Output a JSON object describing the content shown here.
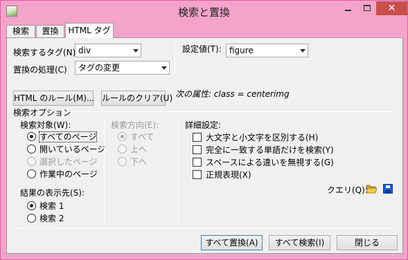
{
  "window": {
    "title": "検索と置換",
    "close_glyph": "✕"
  },
  "tabs": [
    {
      "label": "検索"
    },
    {
      "label": "置換"
    },
    {
      "label": "HTML タグ"
    }
  ],
  "form": {
    "search_tag_label": "検索するタグ(N):",
    "search_tag_value": "div",
    "replace_action_label": "置換の処理(C)",
    "replace_action_value": "タグの変更",
    "setting_value_label": "設定値(T):",
    "setting_value": "figure",
    "html_rules_button": "HTML のルール(M)...",
    "clear_rules_button": "ルールのクリア(U)",
    "next_attr_label": "次の属性:",
    "next_attr_value": "class = centerimg"
  },
  "search_options": {
    "group_label": "検索オプション",
    "target_label": "検索対象(W):",
    "targets": [
      {
        "label": "すべてのページ",
        "checked": true,
        "disabled": false
      },
      {
        "label": "開いているページ",
        "checked": false,
        "disabled": false
      },
      {
        "label": "選択したページ",
        "checked": false,
        "disabled": true
      },
      {
        "label": "作業中のページ",
        "checked": false,
        "disabled": false
      }
    ],
    "results_label": "結果の表示先(S):",
    "results": [
      {
        "label": "検索 1",
        "checked": true
      },
      {
        "label": "検索 2",
        "checked": false
      }
    ],
    "direction_label": "検索方向(E):",
    "directions": [
      {
        "label": "すべて",
        "checked": true
      },
      {
        "label": "上へ",
        "checked": false
      },
      {
        "label": "下へ",
        "checked": false
      }
    ],
    "advanced_label": "詳細設定:",
    "advanced": [
      {
        "label": "大文字と小文字を区別する(H)",
        "checked": false
      },
      {
        "label": "完全に一致する単語だけを検索(Y)",
        "checked": false
      },
      {
        "label": "スペースによる違いを無視する(G)",
        "checked": false
      },
      {
        "label": "正規表現(X)",
        "checked": false
      }
    ],
    "query_label": "クエリ(Q):"
  },
  "buttons": {
    "replace_all": "すべて置換(A)",
    "search_all": "すべて検索(I)",
    "close": "閉じる"
  },
  "colors": {
    "frame": "#f4a3cb",
    "close_button": "#c7504b",
    "dialog_bg": "#f0f0f0"
  }
}
